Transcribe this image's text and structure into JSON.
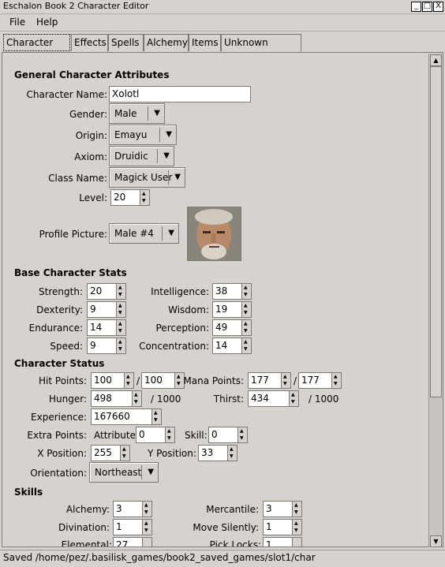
{
  "window": {
    "title": "Eschalon Book 2 Character Editor",
    "btn_min": "_",
    "btn_max": "□",
    "btn_close": "X"
  },
  "menu": [
    {
      "label": "File"
    },
    {
      "label": "Help"
    }
  ],
  "tabs": [
    "Character Info",
    "Effects",
    "Spells",
    "Alchemy",
    "Items",
    "Unknown Values"
  ],
  "general": {
    "heading": "General Character Attributes",
    "name_label": "Character Name:",
    "name_value": "Xolotl",
    "gender_label": "Gender:",
    "gender_value": "Male",
    "origin_label": "Origin:",
    "origin_value": "Emayu",
    "axiom_label": "Axiom:",
    "axiom_value": "Druidic",
    "class_label": "Class Name:",
    "class_value": "Magick User",
    "level_label": "Level:",
    "level_value": "20",
    "picture_label": "Profile Picture:",
    "picture_value": "Male #4"
  },
  "stats": {
    "heading": "Base Character Stats",
    "strength_label": "Strength:",
    "strength": "20",
    "dexterity_label": "Dexterity:",
    "dexterity": "9",
    "endurance_label": "Endurance:",
    "endurance": "14",
    "speed_label": "Speed:",
    "speed": "9",
    "intelligence_label": "Intelligence:",
    "intelligence": "38",
    "wisdom_label": "Wisdom:",
    "wisdom": "19",
    "perception_label": "Perception:",
    "perception": "49",
    "concentration_label": "Concentration:",
    "concentration": "14"
  },
  "status": {
    "heading": "Character Status",
    "hp_label": "Hit Points:",
    "hp_cur": "100",
    "hp_max": "100",
    "mp_label": "Mana Points:",
    "mp_cur": "177",
    "mp_max": "177",
    "slash": "/",
    "hunger_label": "Hunger:",
    "hunger": "498",
    "hunger_max": "/ 1000",
    "thirst_label": "Thirst:",
    "thirst": "434",
    "thirst_max": "/ 1000",
    "exp_label": "Experience:",
    "exp": "167660",
    "extra_label": "Extra Points:",
    "attr_label": "Attribute:",
    "attr": "0",
    "skill_label": "Skill:",
    "skill": "0",
    "x_label": "X Position:",
    "x": "255",
    "y_label": "Y Position:",
    "y": "33",
    "orient_label": "Orientation:",
    "orient": "Northeast"
  },
  "skills": {
    "heading": "Skills",
    "alchemy_label": "Alchemy:",
    "alchemy": "3",
    "divination_label": "Divination:",
    "divination": "1",
    "elemental_label": "Elemental:",
    "elemental": "27",
    "mercantile_label": "Mercantile:",
    "mercantile": "3",
    "move_label": "Move Silently:",
    "move": "1",
    "picklocks_label": "Pick Locks:",
    "picklocks": "1"
  },
  "statusbar": "Saved /home/pez/.basilisk_games/book2_saved_games/slot1/char"
}
